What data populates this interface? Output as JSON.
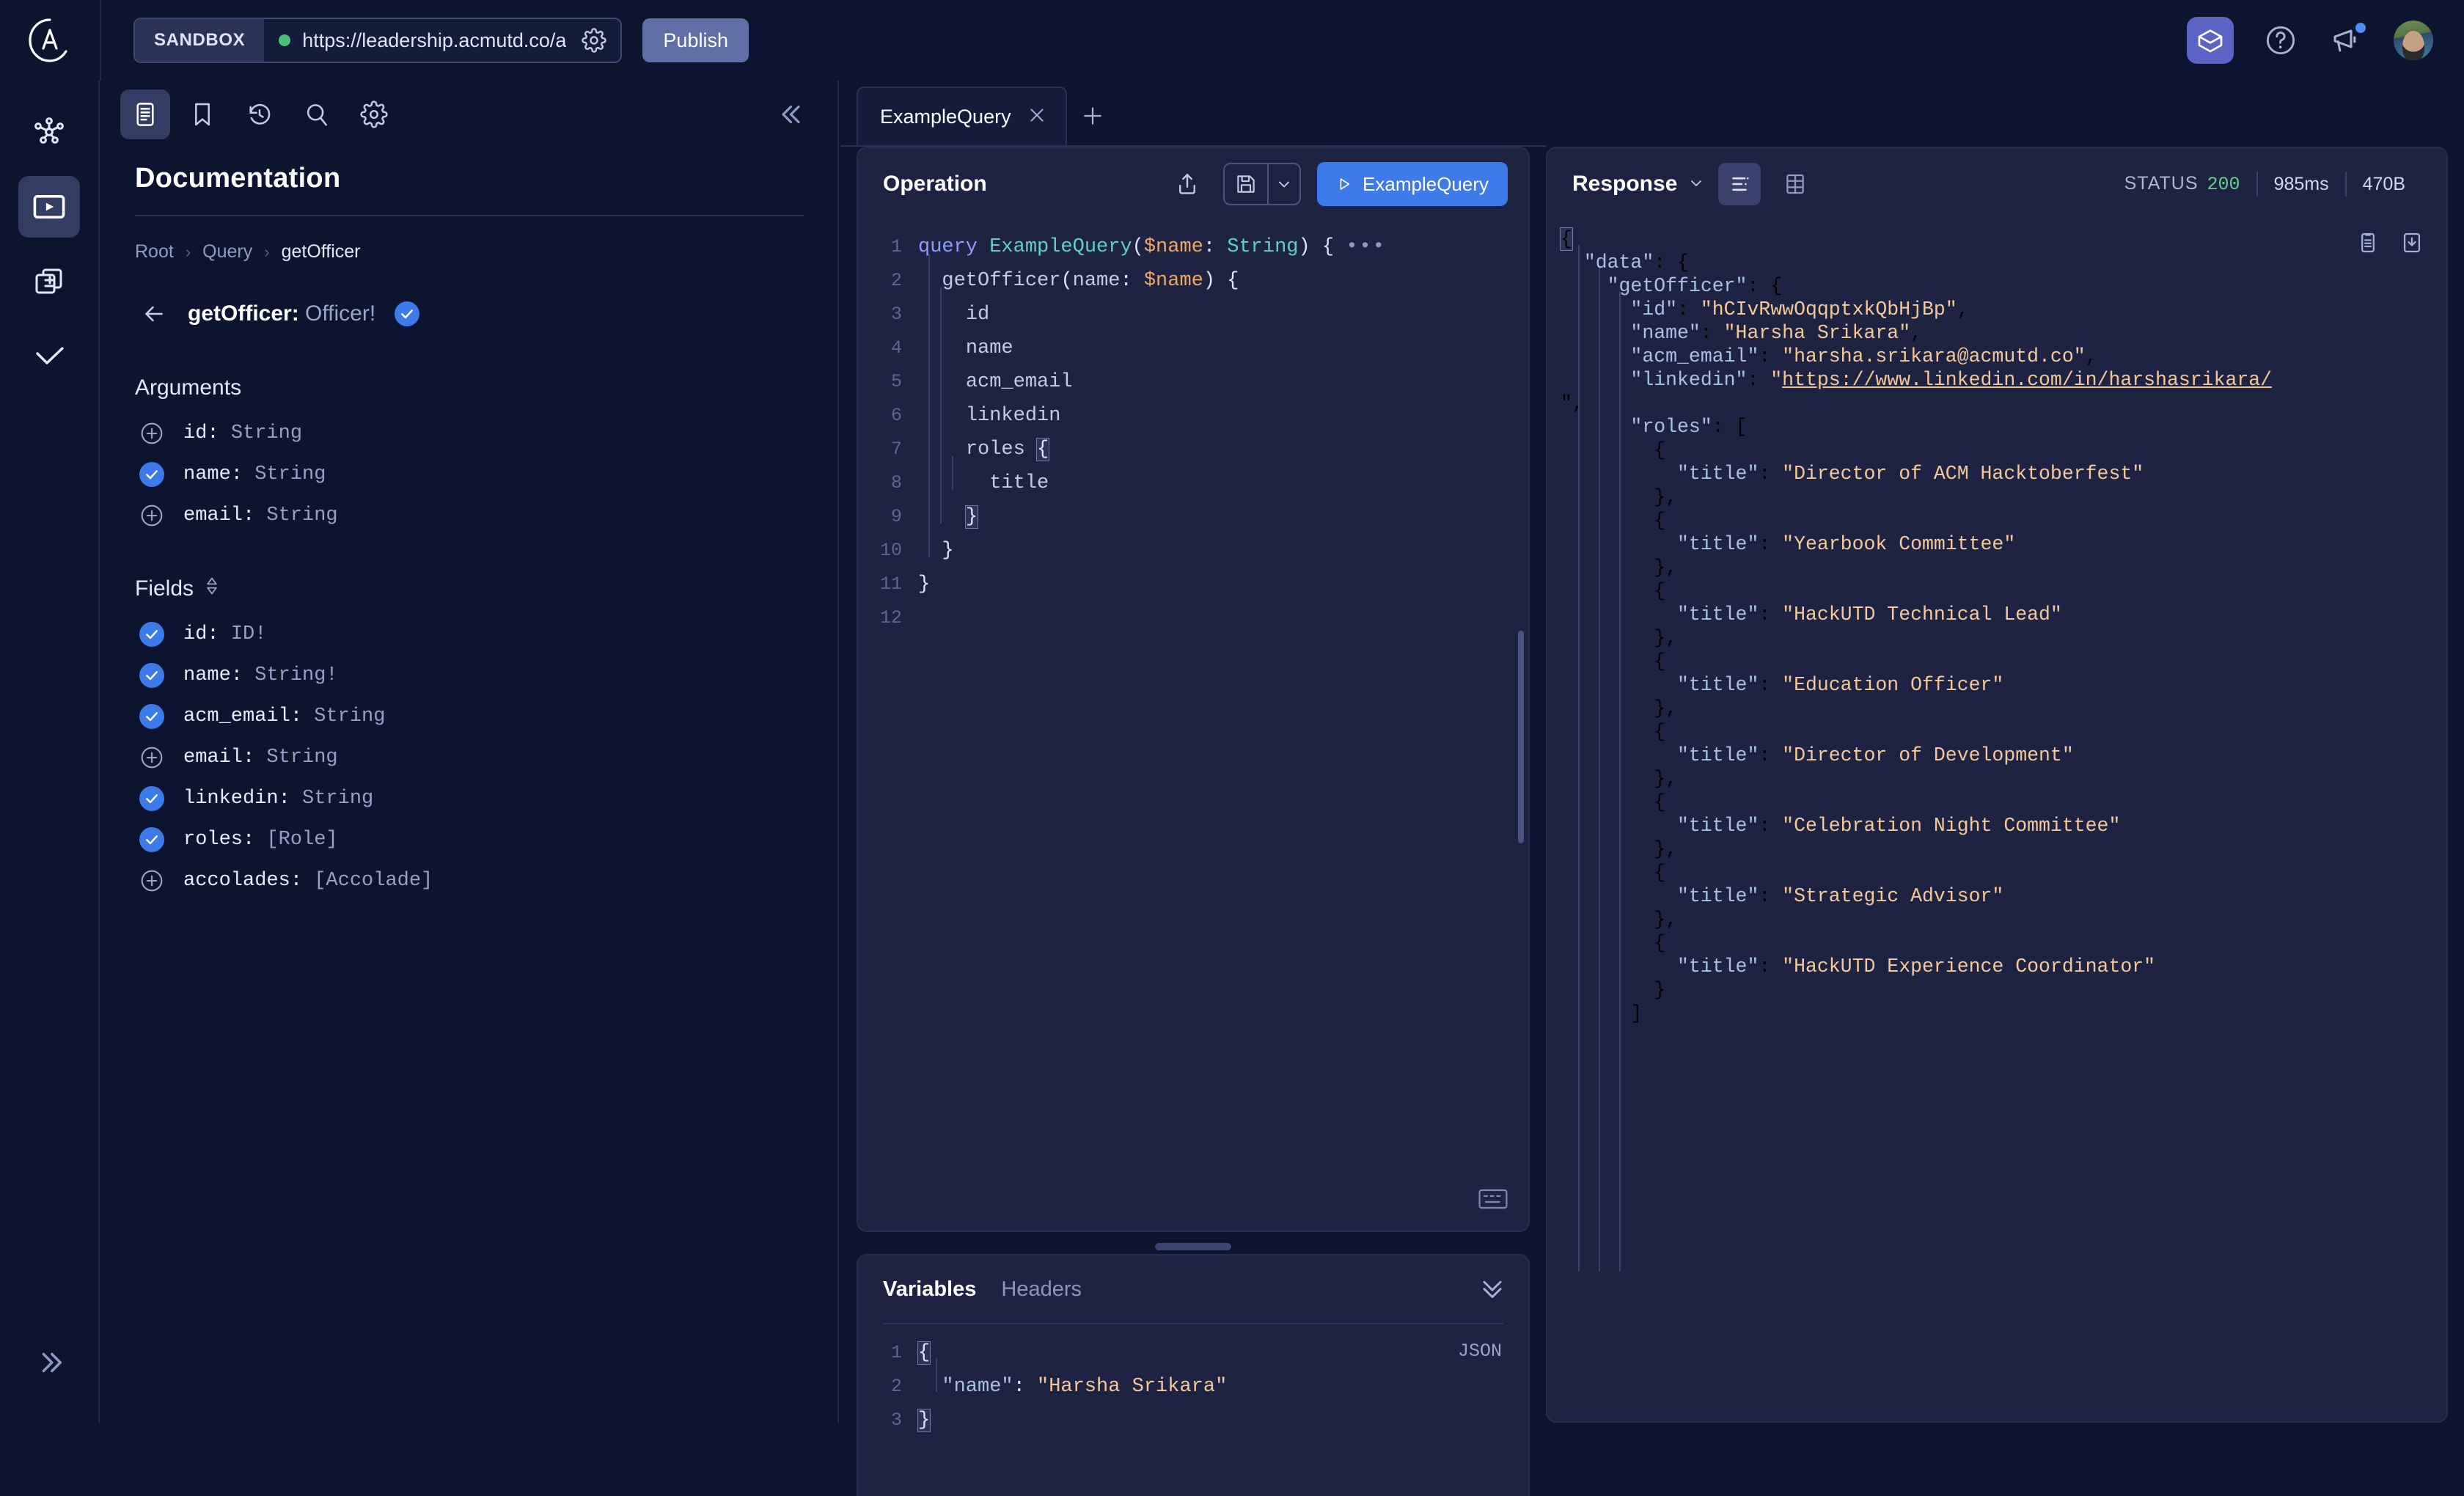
{
  "topbar": {
    "sandbox_chip": "SANDBOX",
    "endpoint_url": "https://leadership.acmutd.co/a",
    "publish_label": "Publish",
    "gear_icon": "gear-icon",
    "status_dot_color": "#4ebf7b",
    "sandbox_icon": "sandbox-box-icon",
    "help_icon": "help-circle-icon",
    "announcements_icon": "megaphone-icon",
    "avatar_icon": "user-avatar"
  },
  "rail": {
    "items": [
      {
        "name": "schema-graph",
        "icon": "graph-nodes-icon",
        "active": false
      },
      {
        "name": "explorer",
        "icon": "play-screen-icon",
        "active": true
      },
      {
        "name": "changelog",
        "icon": "diff-layers-icon",
        "active": false
      },
      {
        "name": "checks",
        "icon": "check-icon",
        "active": false
      }
    ],
    "expand_icon": "chevron-double-right-icon"
  },
  "docs": {
    "toolbar": [
      {
        "name": "documentation",
        "icon": "document-list-icon",
        "active": true
      },
      {
        "name": "bookmarks",
        "icon": "bookmark-icon",
        "active": false
      },
      {
        "name": "history",
        "icon": "history-clock-icon",
        "active": false
      },
      {
        "name": "search",
        "icon": "search-icon",
        "active": false
      },
      {
        "name": "settings",
        "icon": "gear-icon",
        "active": false
      }
    ],
    "collapse_icon": "chevron-double-left-icon",
    "title": "Documentation",
    "breadcrumb": [
      "Root",
      "Query",
      "getOfficer"
    ],
    "breadcrumb_sep": "›",
    "back_icon": "arrow-left-icon",
    "field_name": "getOfficer: ",
    "field_return_type": "Officer!",
    "field_selected": true,
    "arguments_title": "Arguments",
    "arguments": [
      {
        "label": "id: ",
        "type": "String",
        "selected": false
      },
      {
        "label": "name: ",
        "type": "String",
        "selected": true
      },
      {
        "label": "email: ",
        "type": "String",
        "selected": false
      }
    ],
    "fields_title": "Fields",
    "fields_sort_icon": "sort-updown-icon",
    "fields": [
      {
        "label": "id: ",
        "type": "ID!",
        "selected": true
      },
      {
        "label": "name: ",
        "type": "String!",
        "selected": true
      },
      {
        "label": "acm_email: ",
        "type": "String",
        "selected": true
      },
      {
        "label": "email: ",
        "type": "String",
        "selected": false
      },
      {
        "label": "linkedin: ",
        "type": "String",
        "selected": true
      },
      {
        "label": "roles: ",
        "type": "[Role]",
        "selected": true
      },
      {
        "label": "accolades: ",
        "type": "[Accolade]",
        "selected": false
      }
    ]
  },
  "tabs": {
    "items": [
      {
        "label": "ExampleQuery",
        "close_icon": "close-icon",
        "active": true
      }
    ],
    "add_icon": "plus-icon"
  },
  "operation": {
    "title": "Operation",
    "share_icon": "share-upload-icon",
    "save_icon": "save-disk-icon",
    "save_caret_icon": "chevron-down-icon",
    "run_label": "ExampleQuery",
    "run_icon": "play-triangle-icon",
    "keyboard_icon": "keyboard-icon",
    "lines": [
      {
        "n": "1",
        "text": "query ExampleQuery($name: String) { •••"
      },
      {
        "n": "2",
        "text": "  getOfficer(name: $name) {"
      },
      {
        "n": "3",
        "text": "    id"
      },
      {
        "n": "4",
        "text": "    name"
      },
      {
        "n": "5",
        "text": "    acm_email"
      },
      {
        "n": "6",
        "text": "    linkedin"
      },
      {
        "n": "7",
        "text": "    roles {"
      },
      {
        "n": "8",
        "text": "      title"
      },
      {
        "n": "9",
        "text": "    }"
      },
      {
        "n": "10",
        "text": "  }"
      },
      {
        "n": "11",
        "text": "}"
      },
      {
        "n": "12",
        "text": ""
      }
    ]
  },
  "variables": {
    "tab_variables": "Variables",
    "tab_headers": "Headers",
    "collapse_icon": "chevron-double-down-icon",
    "format_label": "JSON",
    "lines": [
      {
        "n": "1",
        "text": "{"
      },
      {
        "n": "2",
        "text": "  \"name\": \"Harsha Srikara\""
      },
      {
        "n": "3",
        "text": "}"
      }
    ]
  },
  "response": {
    "title": "Response",
    "title_caret_icon": "chevron-down-icon",
    "view_json_icon": "json-lines-icon",
    "view_table_icon": "table-grid-icon",
    "view_active": "json",
    "status_label": "STATUS",
    "status_code": "200",
    "status_color": "#62d18e",
    "duration": "985ms",
    "size": "470B",
    "copy_icon": "clipboard-copy-icon",
    "download_icon": "download-icon",
    "json_lines": [
      "{",
      "  \"data\": {",
      "    \"getOfficer\": {",
      "      \"id\": \"hCIvRwwOqqptxkQbHjBp\",",
      "      \"name\": \"Harsha Srikara\",",
      "      \"acm_email\": \"harsha.srikara@acmutd.co\",",
      "      \"linkedin\": \"https://www.linkedin.com/in/harshasrikara/",
      "\",",
      "      \"roles\": [",
      "        {",
      "          \"title\": \"Director of ACM Hacktoberfest\"",
      "        },",
      "        {",
      "          \"title\": \"Yearbook Committee\"",
      "        },",
      "        {",
      "          \"title\": \"HackUTD Technical Lead\"",
      "        },",
      "        {",
      "          \"title\": \"Education Officer\"",
      "        },",
      "        {",
      "          \"title\": \"Director of Development\"",
      "        },",
      "        {",
      "          \"title\": \"Celebration Night Committee\"",
      "        },",
      "        {",
      "          \"title\": \"Strategic Advisor\"",
      "        },",
      "        {",
      "          \"title\": \"HackUTD Experience Coordinator\"",
      "        }",
      "      ]"
    ],
    "data_values": {
      "id": "hCIvRwwOqqptxkQbHjBp",
      "name": "Harsha Srikara",
      "acm_email": "harsha.srikara@acmutd.co",
      "linkedin": "https://www.linkedin.com/in/harshasrikara/",
      "roles": [
        "Director of ACM Hacktoberfest",
        "Yearbook Committee",
        "HackUTD Technical Lead",
        "Education Officer",
        "Director of Development",
        "Celebration Night Committee",
        "Strategic Advisor",
        "HackUTD Experience Coordinator"
      ]
    }
  }
}
